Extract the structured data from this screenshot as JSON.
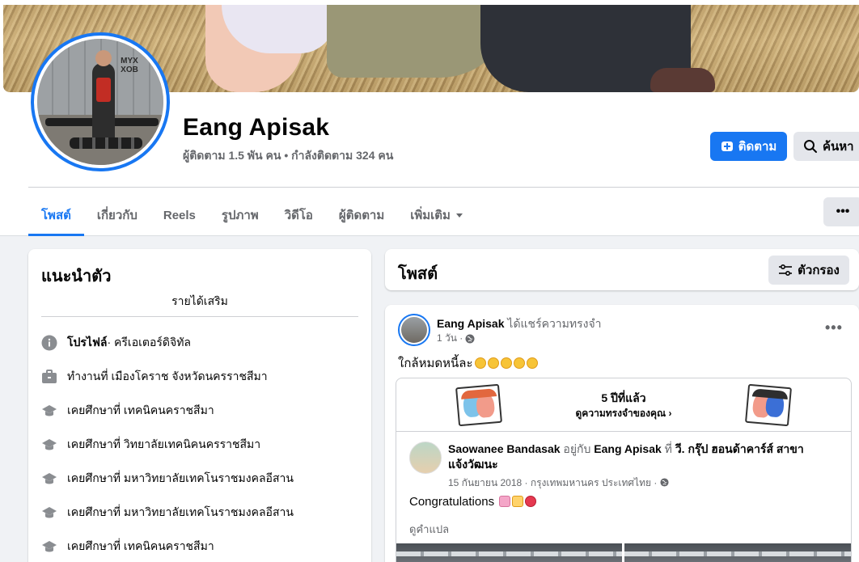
{
  "profile": {
    "name": "Eang Apisak",
    "stats": "ผู้ติดตาม 1.5 พัน คน • กำลังติดตาม 324 คน",
    "avatar_logo": "MYX\nXOB",
    "follow_label": "ติดตาม",
    "search_label": "ค้นหา"
  },
  "tabs": [
    {
      "label": "โพสต์"
    },
    {
      "label": "เกี่ยวกับ"
    },
    {
      "label": "Reels"
    },
    {
      "label": "รูปภาพ"
    },
    {
      "label": "วิดีโอ"
    },
    {
      "label": "ผู้ติดตาม"
    },
    {
      "label": "เพิ่มเติม"
    }
  ],
  "more_menu_label": "•••",
  "intro": {
    "title": "แนะนำตัว",
    "bio": "รายได้เสริม",
    "items": [
      {
        "icon": "info-icon",
        "bold": "โปรไฟล์",
        "text": " · ครีเอเตอร์ดิจิทัล"
      },
      {
        "icon": "briefcase-icon",
        "bold": "",
        "text": "ทำงานที่ เมืองโคราช จังหวัดนครราชสีมา"
      },
      {
        "icon": "graduation-cap-icon",
        "bold": "",
        "text": "เคยศึกษาที่ เทคนิคนคราชสีมา"
      },
      {
        "icon": "graduation-cap-icon",
        "bold": "",
        "text": "เคยศึกษาที่ วิทยาลัยเทคนิคนครราชสีมา"
      },
      {
        "icon": "graduation-cap-icon",
        "bold": "",
        "text": "เคยศึกษาที่ มหาวิทยาลัยเทคโนราชมงคลอีสาน"
      },
      {
        "icon": "graduation-cap-icon",
        "bold": "",
        "text": "เคยศึกษาที่ มหาวิทยาลัยเทคโนราชมงคลอีสาน"
      },
      {
        "icon": "graduation-cap-icon",
        "bold": "",
        "text": "เคยศึกษาที่ เทคนิคนคราชสีมา"
      }
    ]
  },
  "posts": {
    "title": "โพสต์",
    "filter_label": "ตัวกรอง"
  },
  "post": {
    "author": "Eang Apisak",
    "action": " ได้แชร์ความทรงจำ",
    "time": "1 วัน ·",
    "text": "ใกล้หมดหนี้ละ",
    "memory": {
      "years": "5 ปีที่แล้ว",
      "link": "ดูความทรงจำของคุณ ›",
      "author": "Saowanee Bandasak",
      "with_text": " อยู่กับ ",
      "with_name": "Eang Apisak",
      "at_text": " ที่ ",
      "place": "วี. กรุ๊ป ฮอนด้าคาร์ส์ สาขาแจ้งวัฒนะ",
      "time": "15 กันยายน 2018 · กรุงเทพมหานคร ประเทศไทย ·",
      "text": "Congratulations",
      "translate": "ดูคำแปล"
    }
  }
}
